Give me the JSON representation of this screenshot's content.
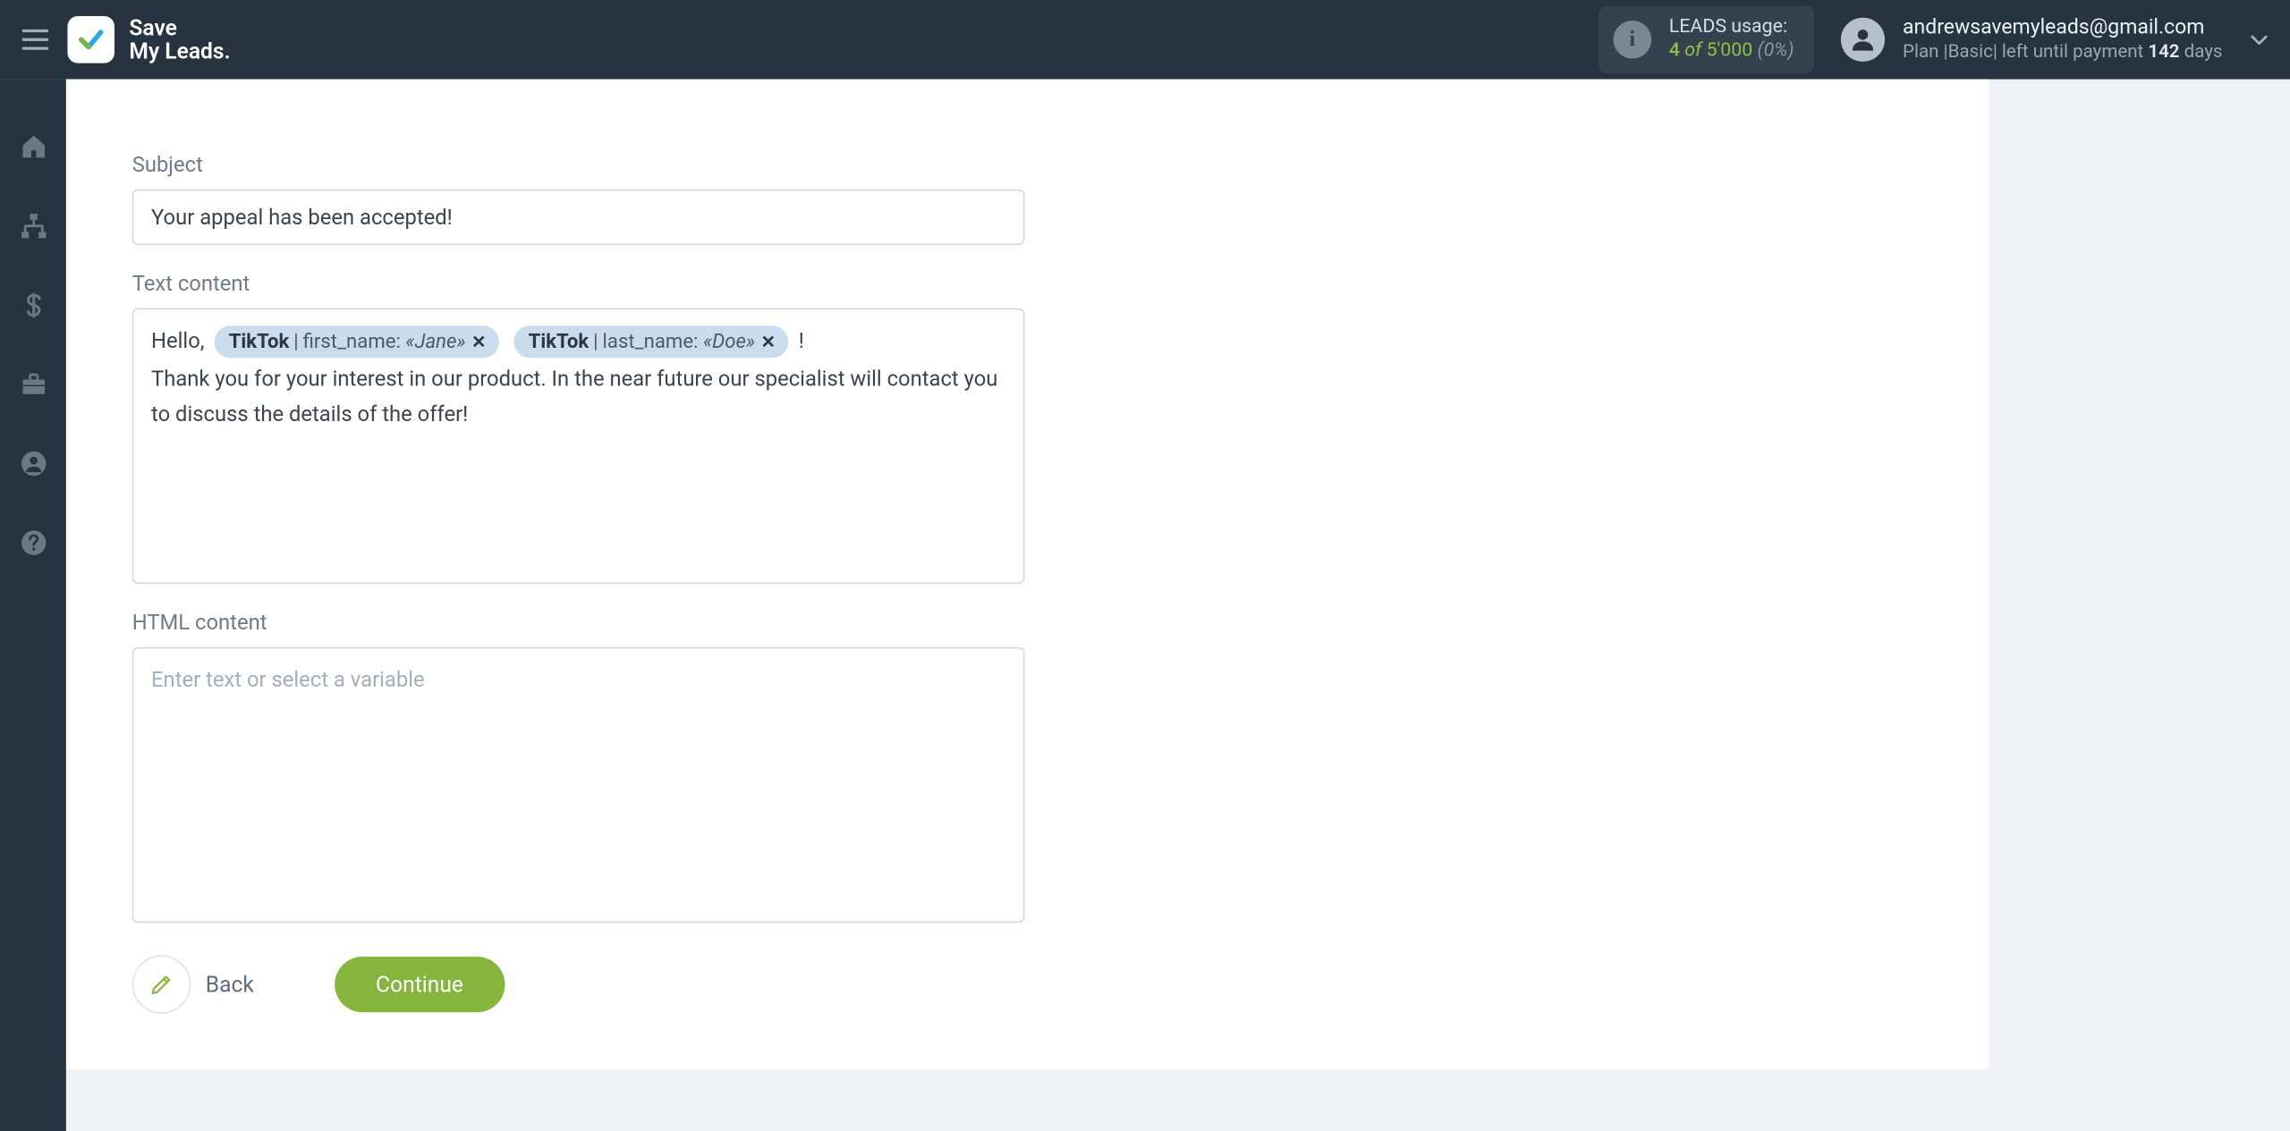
{
  "brand": {
    "line1": "Save",
    "line2": "My Leads."
  },
  "header": {
    "leads_label": "LEADS usage:",
    "usage_current": "4",
    "usage_of": "of",
    "usage_total": "5'000",
    "usage_pct": "(0%)",
    "account_email": "andrewsavemyleads@gmail.com",
    "plan_prefix": "Plan |",
    "plan_name": "Basic",
    "plan_mid": "| left until payment ",
    "plan_days": "142",
    "plan_days_suffix": " days"
  },
  "form": {
    "subject_label": "Subject",
    "subject_value": "Your appeal has been accepted!",
    "text_content_label": "Text content",
    "greeting": "Hello, ",
    "exclaim": " !",
    "body_line": "Thank you for your interest in our product. In the near future our specialist will contact you to discuss the details of the offer!",
    "token1": {
      "source": "TikTok",
      "field": "first_name:",
      "value": "«Jane»"
    },
    "token2": {
      "source": "TikTok",
      "field": "last_name:",
      "value": "«Doe»"
    },
    "html_content_label": "HTML content",
    "html_placeholder": "Enter text or select a variable"
  },
  "buttons": {
    "back": "Back",
    "continue": "Continue"
  }
}
